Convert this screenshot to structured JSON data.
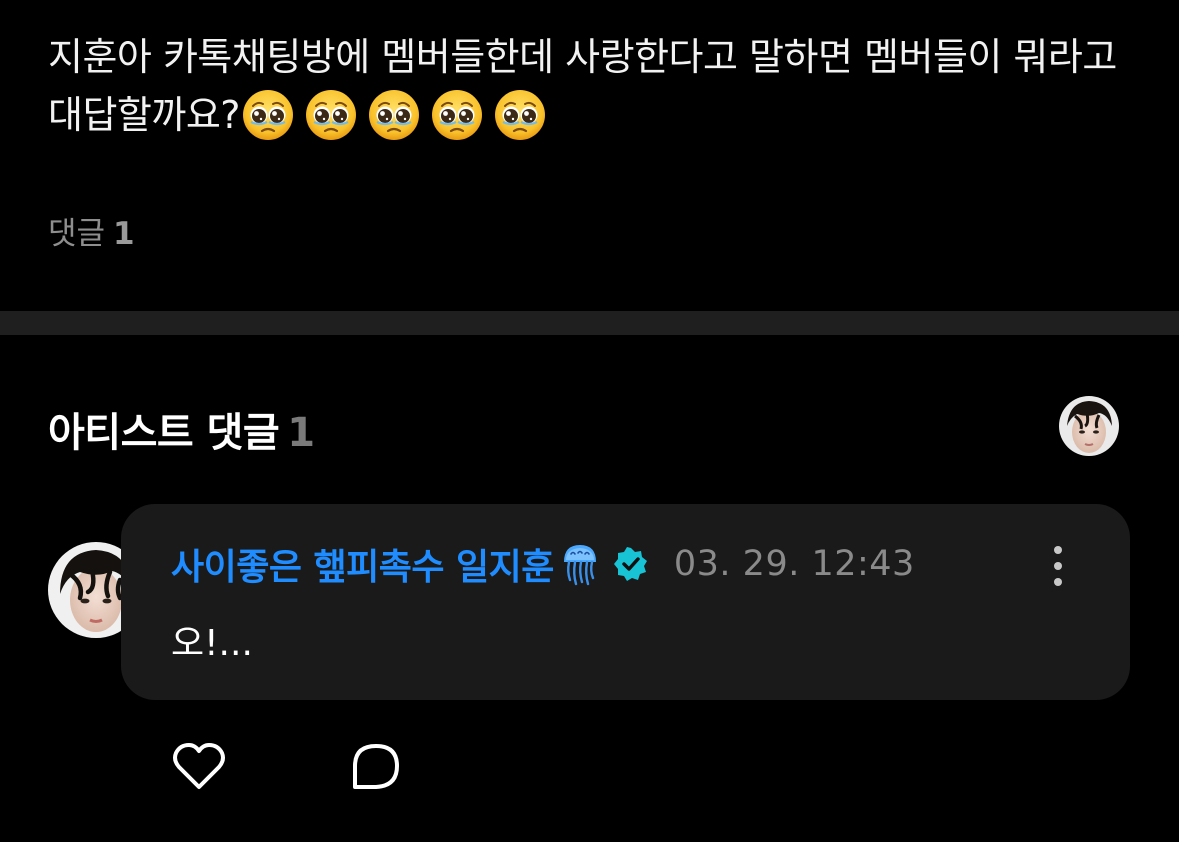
{
  "post": {
    "text": "지훈아 카톡채팅방에 멤버들한데 사랑한다고 말하면 멤버들이 뭐라고  대답할까요?",
    "emoji_icon": "pleading-face-icon",
    "emoji_count": 5,
    "comment_label": "댓글",
    "comment_count": "1"
  },
  "artist_section": {
    "title": "아티스트 댓글",
    "count": "1",
    "avatar_icon": "artist-avatar"
  },
  "comment": {
    "author": "사이좋은 햎피촉수 일지훈",
    "author_emoji": "jellyfish-icon",
    "verified_icon": "verified-badge-icon",
    "timestamp": "03. 29. 12:43",
    "body": "오!...",
    "more_icon": "more-vertical-icon"
  },
  "actions": {
    "like_icon": "heart-icon",
    "reply_icon": "reply-bubble-icon"
  },
  "colors": {
    "background": "#000000",
    "divider": "#1f1f1f",
    "bubble": "#1a1a1a",
    "author_accent": "#1f8cff",
    "verified": "#18c3d6",
    "muted_text": "#8a8a8a"
  }
}
